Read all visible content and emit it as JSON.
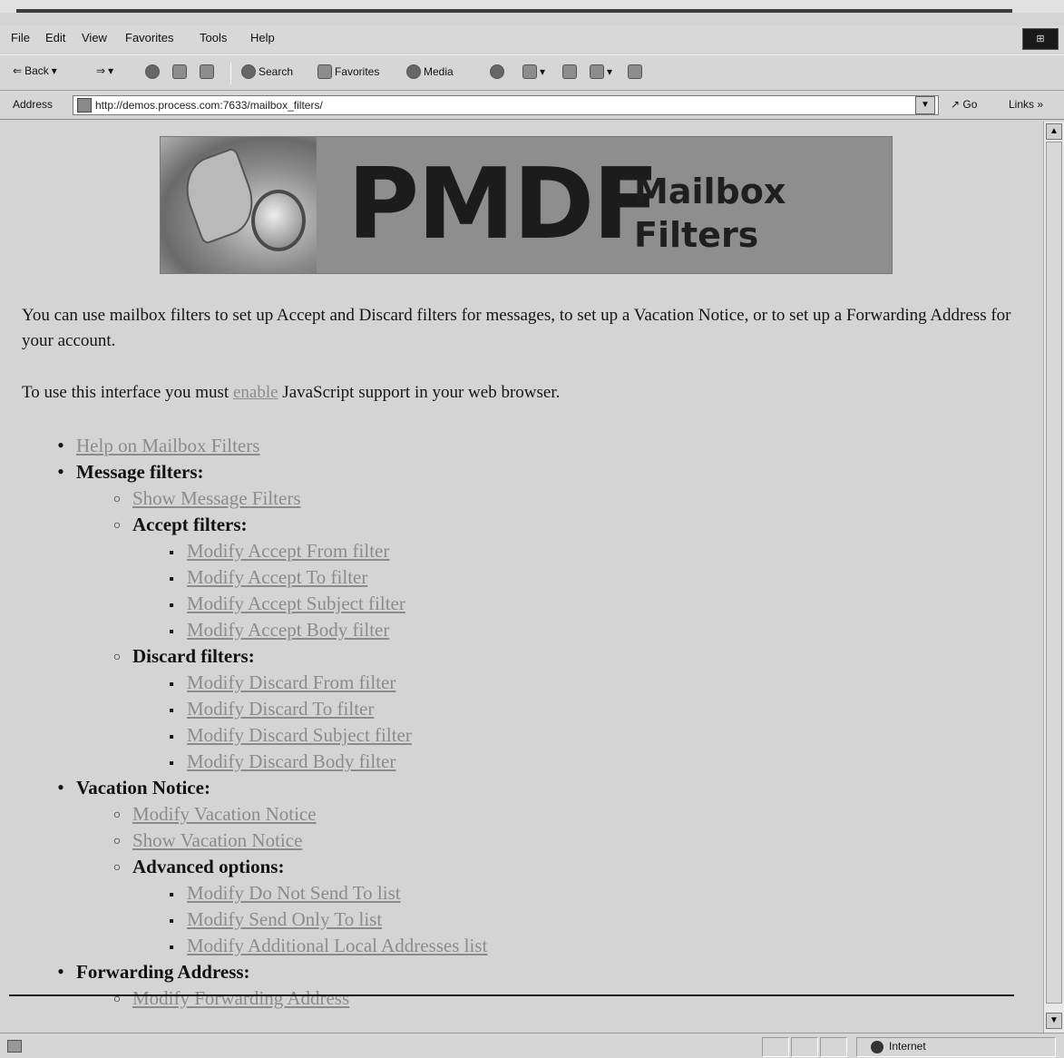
{
  "menu": [
    "File",
    "Edit",
    "View",
    "Favorites",
    "Tools",
    "Help"
  ],
  "toolbar": {
    "back": "Back",
    "search": "Search",
    "favorites": "Favorites",
    "media": "Media"
  },
  "address": {
    "label": "Address",
    "url": "http://demos.process.com:7633/mailbox_filters/",
    "go": "Go",
    "links": "Links »"
  },
  "banner": {
    "brand": "PMDF",
    "line1": "Mailbox",
    "line2": "Filters"
  },
  "intro": "You can use mailbox filters to set up Accept and Discard filters for messages, to set up a Vacation Notice, or to set up a Forwarding Address for your account.",
  "js_notice": {
    "before": "To use this interface you must ",
    "link": "enable",
    "after": " JavaScript support in your web browser."
  },
  "nav": {
    "help": "Help on Mailbox Filters",
    "message_filters": "Message filters:",
    "show_message_filters": "Show Message Filters",
    "accept_filters": "Accept filters:",
    "accept_from": "Modify Accept From filter",
    "accept_to": "Modify Accept To filter",
    "accept_subject": "Modify Accept Subject filter",
    "accept_body": "Modify Accept Body filter",
    "discard_filters": "Discard filters:",
    "discard_from": "Modify Discard From filter",
    "discard_to": "Modify Discard To filter",
    "discard_subject": "Modify Discard Subject filter",
    "discard_body": "Modify Discard Body filter",
    "vacation_notice": "Vacation Notice:",
    "modify_vacation": "Modify Vacation Notice",
    "show_vacation": "Show Vacation Notice",
    "advanced_options": "Advanced options:",
    "do_not_send": "Modify Do Not Send To list",
    "send_only": "Modify Send Only To list",
    "additional_local": "Modify Additional Local Addresses list",
    "forwarding_address": "Forwarding Address:",
    "modify_forwarding": "Modify Forwarding Address"
  },
  "status": {
    "zone": "Internet"
  }
}
